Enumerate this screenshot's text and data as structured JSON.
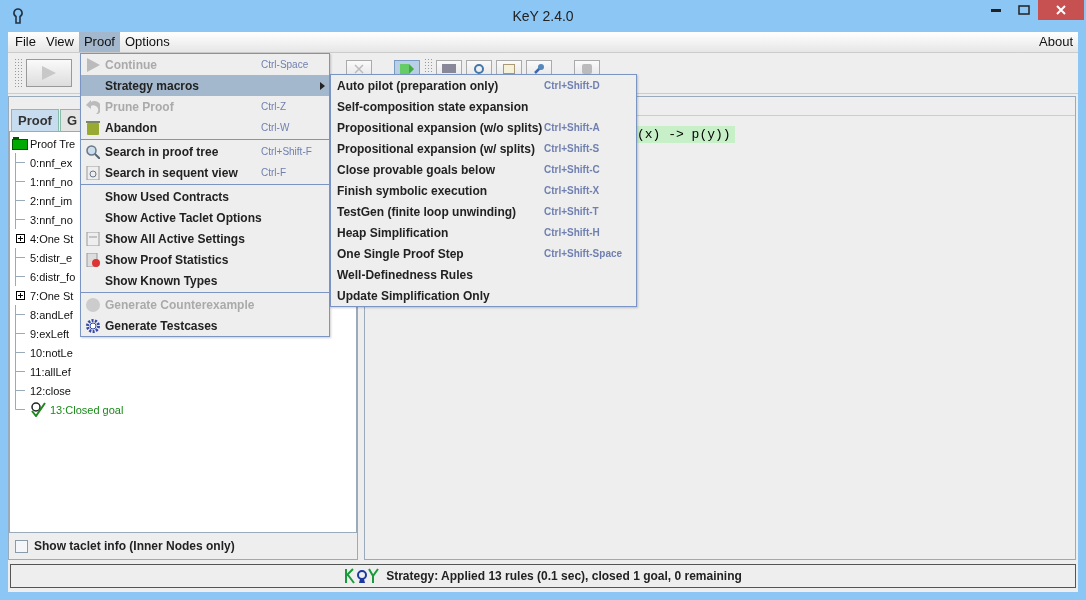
{
  "window": {
    "title": "KeY 2.4.0"
  },
  "menubar": {
    "items": [
      {
        "label": "File",
        "selected": false
      },
      {
        "label": "View",
        "selected": false
      },
      {
        "label": "Proof",
        "selected": true
      },
      {
        "label": "Options",
        "selected": false
      }
    ],
    "right_item": "About"
  },
  "proof_menu": {
    "groups": [
      [
        {
          "label": "Continue",
          "shortcut": "Ctrl-Space",
          "disabled": true,
          "selected": false,
          "submenu": false
        },
        {
          "label": "Strategy macros",
          "disabled": false,
          "selected": true,
          "submenu": true
        },
        {
          "label": "Prune Proof",
          "shortcut": "Ctrl-Z",
          "disabled": true,
          "selected": false,
          "submenu": false
        },
        {
          "label": "Abandon",
          "shortcut": "Ctrl-W",
          "disabled": false,
          "selected": false,
          "submenu": false
        }
      ],
      [
        {
          "label": "Search in proof tree",
          "shortcut": "Ctrl+Shift-F",
          "disabled": false,
          "selected": false,
          "submenu": false
        },
        {
          "label": "Search in sequent view",
          "shortcut": "Ctrl-F",
          "disabled": false,
          "selected": false,
          "submenu": false
        }
      ],
      [
        {
          "label": "Show Used Contracts",
          "disabled": false,
          "selected": false,
          "submenu": false
        },
        {
          "label": "Show Active Taclet Options",
          "disabled": false,
          "selected": false,
          "submenu": false
        },
        {
          "label": "Show All Active Settings",
          "disabled": false,
          "selected": false,
          "submenu": false
        },
        {
          "label": "Show Proof Statistics",
          "disabled": false,
          "selected": false,
          "submenu": false
        },
        {
          "label": "Show Known Types",
          "disabled": false,
          "selected": false,
          "submenu": false
        }
      ],
      [
        {
          "label": "Generate Counterexample",
          "disabled": true,
          "selected": false,
          "submenu": false
        },
        {
          "label": "Generate Testcases",
          "disabled": false,
          "selected": false,
          "submenu": false
        }
      ]
    ]
  },
  "macros_submenu": {
    "items": [
      {
        "label": "Auto pilot (preparation only)",
        "shortcut": "Ctrl+Shift-D"
      },
      {
        "label": "Self-composition state expansion"
      },
      {
        "label": "Propositional expansion (w/o splits)",
        "shortcut": "Ctrl+Shift-A"
      },
      {
        "label": "Propositional expansion (w/ splits)",
        "shortcut": "Ctrl+Shift-S"
      },
      {
        "label": "Close provable goals below",
        "shortcut": "Ctrl+Shift-C"
      },
      {
        "label": "Finish symbolic execution",
        "shortcut": "Ctrl+Shift-X"
      },
      {
        "label": "TestGen (finite loop unwinding)",
        "shortcut": "Ctrl+Shift-T"
      },
      {
        "label": "Heap Simplification",
        "shortcut": "Ctrl+Shift-H"
      },
      {
        "label": "One Single Proof Step",
        "shortcut": "Ctrl+Shift-Space"
      },
      {
        "label": "Well-Definedness Rules"
      },
      {
        "label": "Update Simplification Only"
      }
    ]
  },
  "left_panel": {
    "tabs": [
      {
        "label": "Proof",
        "selected": true
      },
      {
        "label": "G",
        "selected": false
      }
    ],
    "tree": {
      "label": "Proof Tre",
      "children": [
        {
          "label": "0:nnf_ex",
          "kind": "leaf"
        },
        {
          "label": "1:nnf_no",
          "kind": "leaf"
        },
        {
          "label": "2:nnf_im",
          "kind": "leaf"
        },
        {
          "label": "3:nnf_no",
          "kind": "leaf"
        },
        {
          "label": "4:One St",
          "kind": "branch",
          "expanded": false
        },
        {
          "label": "5:distr_e",
          "kind": "leaf"
        },
        {
          "label": "6:distr_fo",
          "kind": "leaf"
        },
        {
          "label": "7:One St",
          "kind": "branch",
          "expanded": false
        },
        {
          "label": "8:andLef",
          "kind": "leaf"
        },
        {
          "label": "9:exLeft",
          "kind": "leaf"
        },
        {
          "label": "10:notLe",
          "kind": "leaf"
        },
        {
          "label": "11:allLef",
          "kind": "leaf"
        },
        {
          "label": "12:close",
          "kind": "leaf"
        },
        {
          "label": "13:Closed goal",
          "kind": "goal"
        }
      ]
    },
    "taclet_info": {
      "label": "Show taclet info (Inner Nodes only)",
      "checked": false
    }
  },
  "sequent": {
    "text": "(x) -> p(y))"
  },
  "status_bar": {
    "text": "Strategy: Applied 13 rules (0.1 sec),  closed 1 goal, 0 remaining"
  }
}
